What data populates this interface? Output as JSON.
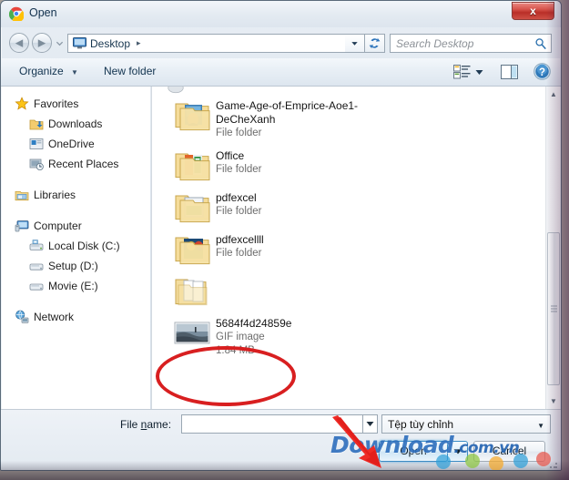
{
  "window": {
    "title": "Open",
    "app_icon": "chrome-logo-icon",
    "close_label": "x"
  },
  "navigation": {
    "back_icon": "back-arrow-icon",
    "forward_icon": "forward-arrow-icon",
    "recent_locations_icon": "chevron-down-icon",
    "breadcrumb": {
      "location_icon": "monitor-icon",
      "location": "Desktop",
      "separator": "▸"
    },
    "address_dropdown_icon": "chevron-down-icon",
    "refresh_icon": "refresh-icon",
    "search": {
      "placeholder": "Search Desktop",
      "value": "",
      "icon": "search-icon"
    }
  },
  "command_bar": {
    "organize_label": "Organize",
    "organize_caret": "▼",
    "new_folder_label": "New folder",
    "view_options_icon": "view-options-icon",
    "view_options_caret": "▼",
    "preview_pane_icon": "preview-pane-icon",
    "help_icon": "help-question-icon"
  },
  "nav_pane": {
    "groups": [
      {
        "header": {
          "label": "Favorites",
          "icon": "star-icon"
        },
        "items": [
          {
            "label": "Downloads",
            "icon": "downloads-folder-icon"
          },
          {
            "label": "OneDrive",
            "icon": "onedrive-icon"
          },
          {
            "label": "Recent Places",
            "icon": "recent-places-icon"
          }
        ]
      },
      {
        "header": {
          "label": "Libraries",
          "icon": "libraries-icon"
        },
        "items": []
      },
      {
        "header": {
          "label": "Computer",
          "icon": "computer-icon"
        },
        "items": [
          {
            "label": "Local Disk (C:)",
            "icon": "system-drive-icon"
          },
          {
            "label": "Setup (D:)",
            "icon": "drive-icon"
          },
          {
            "label": "Movie  (E:)",
            "icon": "drive-icon"
          }
        ]
      },
      {
        "header": {
          "label": "Network",
          "icon": "network-icon"
        },
        "items": []
      }
    ]
  },
  "file_list": {
    "items": [
      {
        "name": "Game-Age-of-Emprice-Aoe1-DeCheXanh",
        "type": "File folder",
        "size": "",
        "icon": "folder-with-picture-icon",
        "selected": false
      },
      {
        "name": "Office",
        "type": "File folder",
        "size": "",
        "icon": "folder-with-office-icon",
        "selected": false
      },
      {
        "name": "pdfexcel",
        "type": "File folder",
        "size": "",
        "icon": "folder-with-green-icon",
        "selected": false
      },
      {
        "name": "pdfexcellll",
        "type": "File folder",
        "size": "",
        "icon": "folder-with-colors-icon",
        "selected": false
      },
      {
        "name": "",
        "type": "",
        "size": "",
        "icon": "empty-folder-icon",
        "selected": false
      },
      {
        "name": "5684f4d24859e",
        "type": "GIF image",
        "size": "1.84 MB",
        "icon": "gif-thumbnail-icon",
        "selected": false,
        "highlighted": true
      }
    ],
    "scrollbar": {
      "up_arrow": "▲",
      "down_arrow": "▼"
    }
  },
  "footer": {
    "filename_label_pre": "File ",
    "filename_label_key": "n",
    "filename_label_post": "ame:",
    "filename_value": "",
    "filename_placeholder": "",
    "filename_dropdown_icon": "chevron-down-icon",
    "filetype_value": "Tệp tùy chỉnh",
    "filetype_caret": "▼",
    "open_label": "Open",
    "open_split_caret": "▼",
    "cancel_label": "Cancel"
  },
  "annotations": {
    "ellipse_target": "5684f4d24859e",
    "arrow_target": "Open",
    "accent_red": "#d81f20",
    "watermark": {
      "brand": "Download",
      "tld": ".com.vn",
      "color": "#2669b9",
      "dot_colors": [
        "#8dc63f",
        "#f7a928",
        "#2f9fd8",
        "#e8544a"
      ]
    }
  }
}
